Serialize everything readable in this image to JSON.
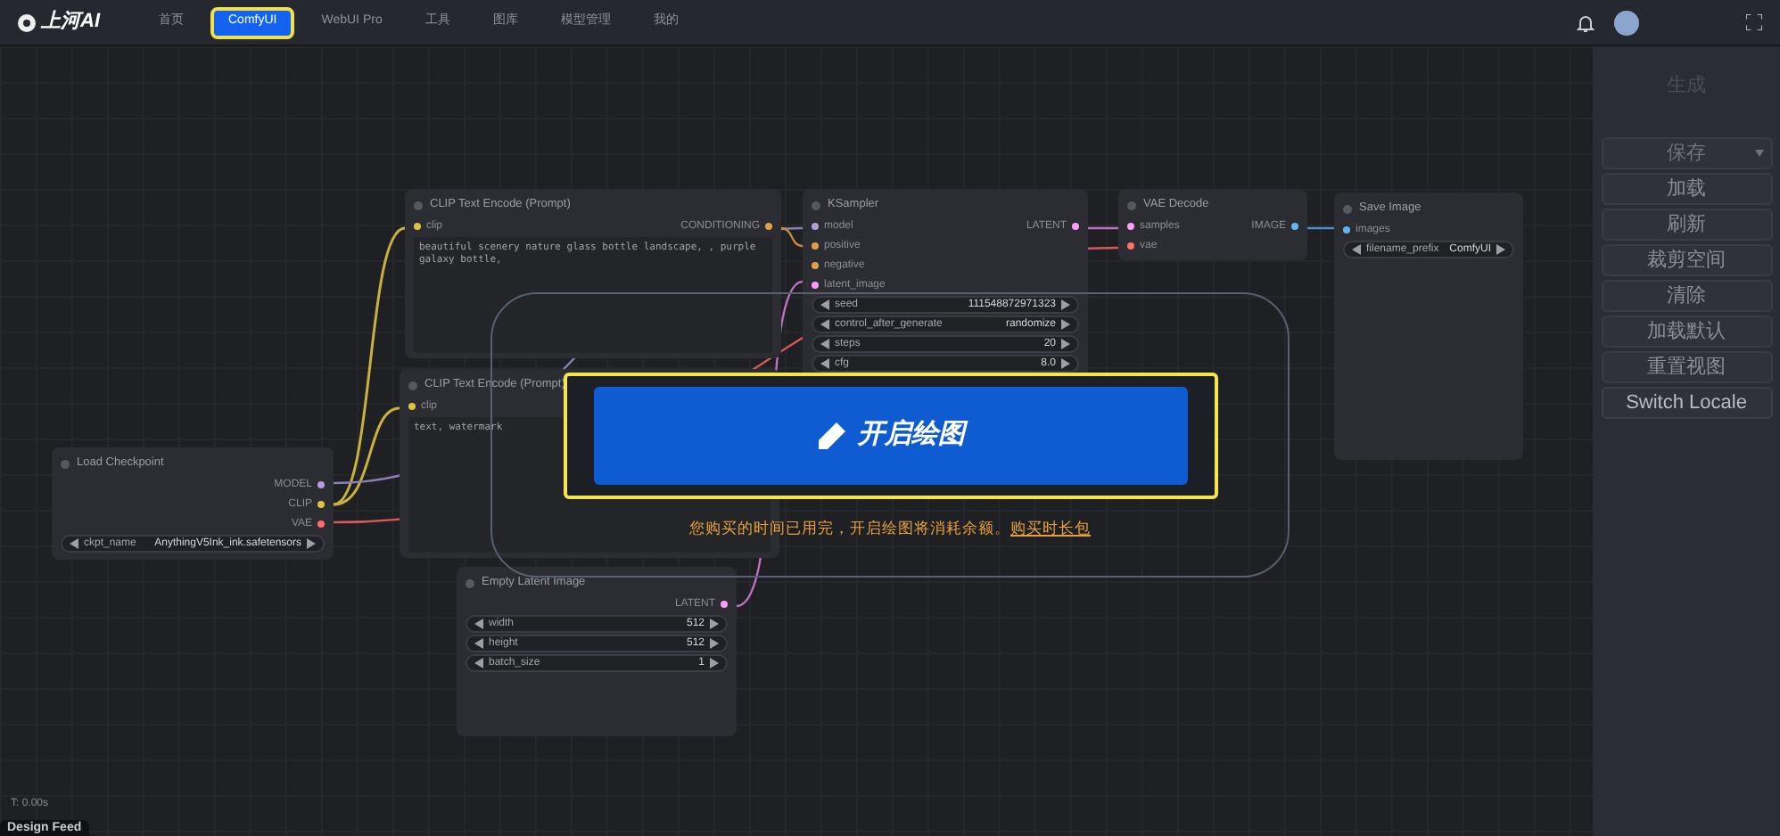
{
  "topbar": {
    "logo": "上河AI",
    "tabs": [
      {
        "label": "首页",
        "selected": false
      },
      {
        "label": "ComfyUI",
        "selected": true
      },
      {
        "label": "WebUI Pro",
        "selected": false
      },
      {
        "label": "工具",
        "selected": false
      },
      {
        "label": "图库",
        "selected": false
      },
      {
        "label": "模型管理",
        "selected": false
      },
      {
        "label": "我的",
        "selected": false
      }
    ]
  },
  "canvas": {
    "nodes": [
      {
        "title": "CLIP Text Encode (Prompt)",
        "inputs": [
          {
            "name": "clip",
            "color": "#e0c341"
          }
        ],
        "outputs": [
          {
            "name": "CONDITIONING",
            "color": "#e0a04a"
          }
        ],
        "text": "beautiful scenery nature glass bottle landscape, , purple galaxy bottle,"
      },
      {
        "title": "CLIP Text Encode (Prompt)",
        "inputs": [
          {
            "name": "clip",
            "color": "#e0c341"
          }
        ],
        "text": "text, watermark"
      },
      {
        "title": "KSampler",
        "inputs": [
          {
            "name": "model",
            "color": "#b39ddb"
          },
          {
            "name": "positive",
            "color": "#e0a04a"
          },
          {
            "name": "negative",
            "color": "#e0a04a"
          },
          {
            "name": "latent_image",
            "color": "#ff9cf9"
          }
        ],
        "outputs": [
          {
            "name": "LATENT",
            "color": "#ff9cf9"
          }
        ],
        "widgets": [
          {
            "name": "seed",
            "value": "111548872971323"
          },
          {
            "name": "control_after_generate",
            "value": "randomize"
          },
          {
            "name": "steps",
            "value": "20"
          },
          {
            "name": "cfg",
            "value": "8.0"
          }
        ]
      },
      {
        "title": "VAE Decode",
        "inputs": [
          {
            "name": "samples",
            "color": "#ff9cf9"
          },
          {
            "name": "vae",
            "color": "#ff6e6e"
          }
        ],
        "outputs": [
          {
            "name": "IMAGE",
            "color": "#64b5f6"
          }
        ]
      },
      {
        "title": "Save Image",
        "inputs": [
          {
            "name": "images",
            "color": "#64b5f6"
          }
        ],
        "widgets": [
          {
            "name": "filename_prefix",
            "value": "ComfyUI"
          }
        ]
      },
      {
        "title": "Load Checkpoint",
        "outputs": [
          {
            "name": "MODEL",
            "color": "#b39ddb"
          },
          {
            "name": "CLIP",
            "color": "#e0c341"
          },
          {
            "name": "VAE",
            "color": "#ff6e6e"
          }
        ],
        "widgets": [
          {
            "name": "ckpt_name",
            "value": "AnythingV5Ink_ink.safetensors"
          }
        ]
      },
      {
        "title": "Empty Latent Image",
        "outputs": [
          {
            "name": "LATENT",
            "color": "#ff9cf9"
          }
        ],
        "widgets": [
          {
            "name": "width",
            "value": "512"
          },
          {
            "name": "height",
            "value": "512"
          },
          {
            "name": "batch_size",
            "value": "1"
          }
        ]
      }
    ],
    "timer": "T: 0.00s"
  },
  "dialog": {
    "button": "开启绘图",
    "notice": "您购买的时间已用完，开启绘图将消耗余额。",
    "link": "购买时长包"
  },
  "side_panel": {
    "title": "生成",
    "buttons": [
      {
        "label": "保存",
        "kind": "split"
      },
      {
        "label": "加载",
        "kind": "plain"
      },
      {
        "label": "刷新",
        "kind": "plain"
      },
      {
        "label": "裁剪空间",
        "kind": "plain"
      },
      {
        "label": "清除",
        "kind": "plain"
      },
      {
        "label": "加载默认",
        "kind": "plain"
      },
      {
        "label": "重置视图",
        "kind": "plain"
      },
      {
        "label": "Switch Locale",
        "kind": "bright"
      }
    ]
  },
  "bottom_tab": "Design Feed"
}
